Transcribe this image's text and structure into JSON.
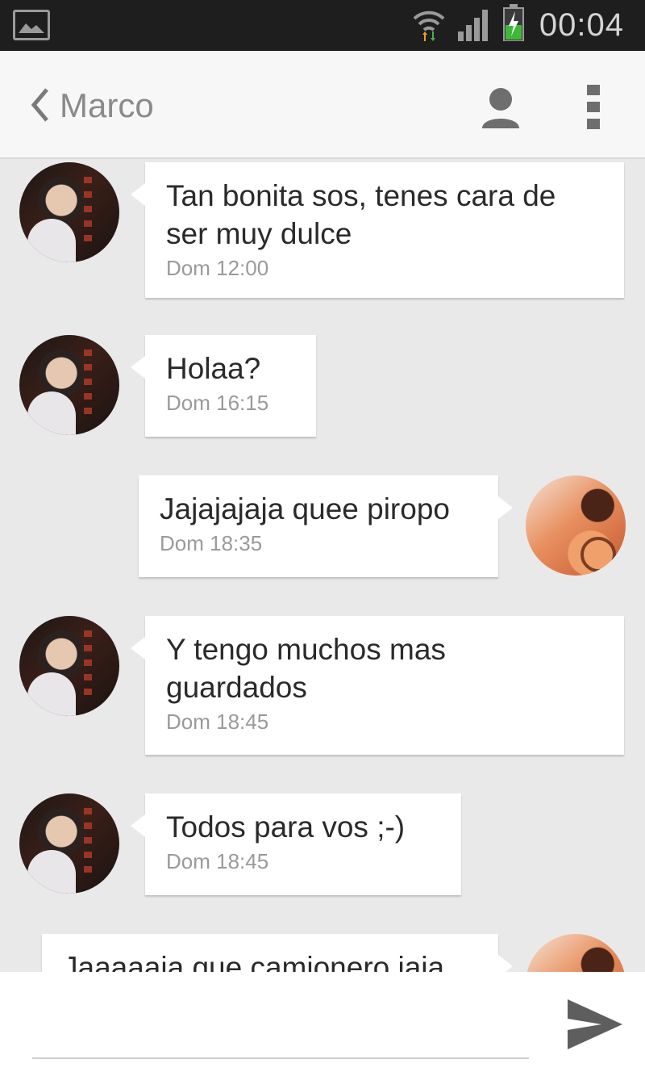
{
  "status_bar": {
    "time": "00:04",
    "icons": [
      "gallery-icon",
      "wifi-icon",
      "signal-icon",
      "battery-charging-icon"
    ]
  },
  "header": {
    "title": "Marco",
    "icons": [
      "back-arrow-icon",
      "contact-icon",
      "overflow-menu-icon"
    ]
  },
  "messages": [
    {
      "direction": "incoming",
      "text": "Tan bonita sos, tenes cara de ser muy dulce",
      "time": "Dom  12:00"
    },
    {
      "direction": "incoming",
      "text": "Holaa?",
      "time": "Dom  16:15"
    },
    {
      "direction": "outgoing",
      "text": "Jajajajaja quee piropo",
      "time": "Dom  18:35"
    },
    {
      "direction": "incoming",
      "text": "Y tengo muchos mas guardados",
      "time": "Dom  18:45"
    },
    {
      "direction": "incoming",
      "text": "Todos para vos ;-)",
      "time": "Dom  18:45"
    },
    {
      "direction": "outgoing",
      "text": "Jaaaaaja que camionero jaja",
      "time": ""
    }
  ],
  "composer": {
    "value": "",
    "placeholder": "",
    "send_icon": "send-icon"
  },
  "colors": {
    "status_bar": "#1e1e1e",
    "app_bar": "#f7f7f7",
    "thread_background": "#e9e9e9",
    "bubble": "#ffffff",
    "battery_green": "#3fb83a"
  }
}
